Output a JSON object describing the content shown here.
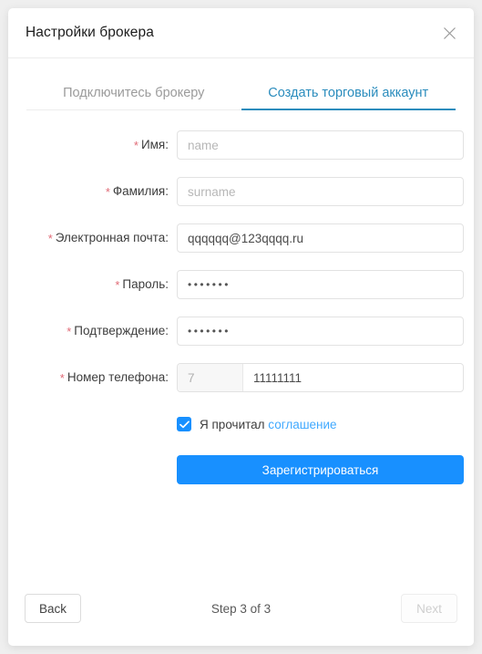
{
  "dialog": {
    "title": "Настройки брокера",
    "close_icon": "close-icon"
  },
  "tabs": [
    {
      "label": "Подключитесь брокеру",
      "active": false
    },
    {
      "label": "Создать торговый аккаунт",
      "active": true
    }
  ],
  "form": {
    "fields": [
      {
        "label": "Имя",
        "required": true,
        "value": "",
        "placeholder": "name",
        "type": "text"
      },
      {
        "label": "Фамилия",
        "required": true,
        "value": "",
        "placeholder": "surname",
        "type": "text"
      },
      {
        "label": "Электронная почта",
        "required": true,
        "value": "qqqqqq@123qqqq.ru",
        "placeholder": "",
        "type": "email"
      },
      {
        "label": "Пароль",
        "required": true,
        "value": "•••••••",
        "placeholder": "",
        "type": "password"
      },
      {
        "label": "Подтверждение",
        "required": true,
        "value": "•••••••",
        "placeholder": "",
        "type": "password"
      }
    ],
    "phone": {
      "label": "Номер телефона",
      "required": true,
      "prefix": "7",
      "value": "11111111"
    },
    "agreement": {
      "checked": true,
      "text": "Я прочитал",
      "link_text": "соглашение"
    },
    "submit_label": "Зарегистрироваться"
  },
  "footer": {
    "back_label": "Back",
    "step_text": "Step 3 of 3",
    "next_label": "Next",
    "next_disabled": true
  },
  "colors": {
    "accent_blue": "#1890ff",
    "tab_active": "#2a8cbd",
    "link_blue": "#40a9ff",
    "required_star": "#e06a76"
  }
}
